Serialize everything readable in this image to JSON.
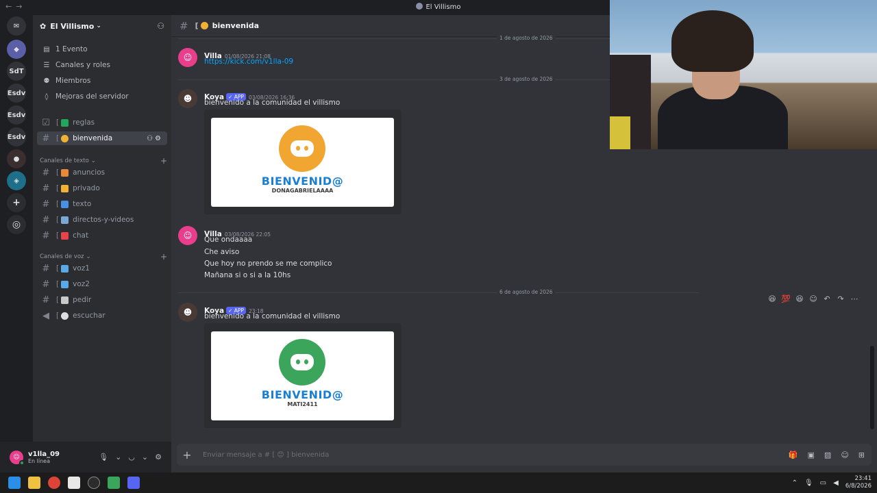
{
  "window": {
    "title": "El Villismo"
  },
  "servers": [
    "SdT",
    "Esdv",
    "Esdv",
    "Esdv"
  ],
  "guild": {
    "name": "El Villismo"
  },
  "menu": [
    {
      "label": "1 Evento",
      "icon": "calendar-icon"
    },
    {
      "label": "Canales y roles",
      "icon": "list-icon"
    },
    {
      "label": "Miembros",
      "icon": "members-icon"
    },
    {
      "label": "Mejoras del servidor",
      "icon": "boost-icon"
    }
  ],
  "top_channels": [
    {
      "bracket": "[",
      "emoji_color": "#23a55a",
      "label": "reglas"
    },
    {
      "bracket": "[",
      "emoji_color": "#f0b232",
      "label": "bienvenida"
    }
  ],
  "text_category": {
    "label": "Canales de texto"
  },
  "text_channels": [
    {
      "bracket": "[",
      "emoji_color": "#e8883a",
      "label": "anuncios"
    },
    {
      "bracket": "[",
      "emoji_color": "#f0b232",
      "label": "privado"
    },
    {
      "bracket": "[",
      "emoji_color": "#4a90e2",
      "label": "texto"
    },
    {
      "bracket": "[",
      "emoji_color": "#7aa7d6",
      "label": "directos-y-videos"
    },
    {
      "bracket": "[",
      "emoji_color": "#e8424a",
      "label": "chat"
    }
  ],
  "voice_category": {
    "label": "Canales de voz"
  },
  "voice_channels": [
    {
      "bracket": "[",
      "emoji_color": "#5aa9e6",
      "label": "voz1"
    },
    {
      "bracket": "[",
      "emoji_color": "#5aa9e6",
      "label": "voz2"
    },
    {
      "bracket": "[",
      "emoji_color": "#c9c9c9",
      "label": "pedir"
    },
    {
      "bracket": "[",
      "emoji_color": "#dbdee1",
      "label": "escuchar"
    }
  ],
  "user": {
    "name": "v1lla_09",
    "status": "En línea",
    "avatar_color": "#e83e8c"
  },
  "header": {
    "channel": "bienvenida",
    "bracket": "["
  },
  "dividers": [
    "1 de agosto de 2026",
    "3 de agosto de 2026",
    "6 de agosto de 2026"
  ],
  "messages": [
    {
      "author": "Villa",
      "time": "01/08/2026 21:08",
      "lines": [
        "https://kick.com/v1lla-09"
      ]
    },
    {
      "author": "Koya",
      "badge": "APP",
      "time": "03/08/2026 16:36",
      "lines": [
        "bienvenido a la comunidad el villismo"
      ]
    },
    {
      "author": "Villa",
      "time": "03/08/2026 22:05",
      "lines": [
        "Que ondaaaa",
        "Che aviso",
        "Que hoy no prendo se me complico",
        "Mañana si o si a la 10hs"
      ]
    },
    {
      "author": "Koya",
      "badge": "APP",
      "time": "23:18",
      "lines": [
        "bienvenido a la comunidad el villismo"
      ]
    }
  ],
  "embeds": [
    {
      "title": "BIENVENID@",
      "username": "DONAGABRIELAAAA",
      "circle_color": "#f0a630"
    },
    {
      "title": "BIENVENID@",
      "username": "MATI2411",
      "circle_color": "#3ba55c"
    }
  ],
  "composer": {
    "placeholder": "Enviar mensaje a # [ 😊 ] bienvenida"
  },
  "taskbar": {
    "time": "23:41",
    "date": "6/8/2026"
  }
}
